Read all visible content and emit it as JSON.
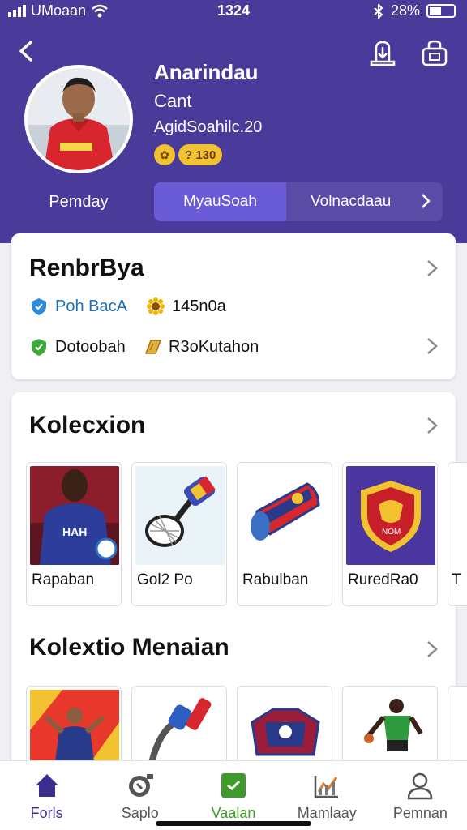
{
  "status_bar": {
    "carrier": "UMoaan",
    "time": "1324",
    "battery": "28%"
  },
  "profile": {
    "name": "Anarindau",
    "subtitle": "Cant",
    "detail": "AgidSoahilc.20",
    "badge_coin": "✿",
    "badge_value": "? 130",
    "tag": "Pemday"
  },
  "tabs": [
    {
      "label": "MyauSoah"
    },
    {
      "label": "Volnacdaau"
    }
  ],
  "stats_card": {
    "title": "RenbrBya",
    "items": [
      {
        "label": "Poh BacA",
        "icon": "shield-icon",
        "color": "#2e8bd8"
      },
      {
        "label": "145n0a",
        "icon": "sunflower-icon",
        "color": "#e0a300"
      },
      {
        "label": "Dotoobah",
        "icon": "shield-check-icon",
        "color": "#3aa83a"
      },
      {
        "label": "R3oKutahon",
        "icon": "tag-icon",
        "color": "#d9a21f"
      }
    ]
  },
  "collection": {
    "title": "Kolecxion",
    "items": [
      {
        "label": "Rapaban"
      },
      {
        "label": "Gol2 Po"
      },
      {
        "label": "Rabulban"
      },
      {
        "label": "RuredRa0"
      },
      {
        "label": "T"
      }
    ]
  },
  "collection2": {
    "title": "Kolextio Menaian"
  },
  "bottom_nav": [
    {
      "label": "Forls",
      "icon": "home-icon"
    },
    {
      "label": "Saplo",
      "icon": "search-badge-icon"
    },
    {
      "label": "Vaalan",
      "icon": "check-box-icon"
    },
    {
      "label": "Mamlaay",
      "icon": "chart-icon"
    },
    {
      "label": "Pemnan",
      "icon": "user-icon"
    }
  ],
  "colors": {
    "header_bg": "#4a3b9a",
    "tab_active": "#6a5cd6",
    "accent_green": "#3e9b2b"
  }
}
